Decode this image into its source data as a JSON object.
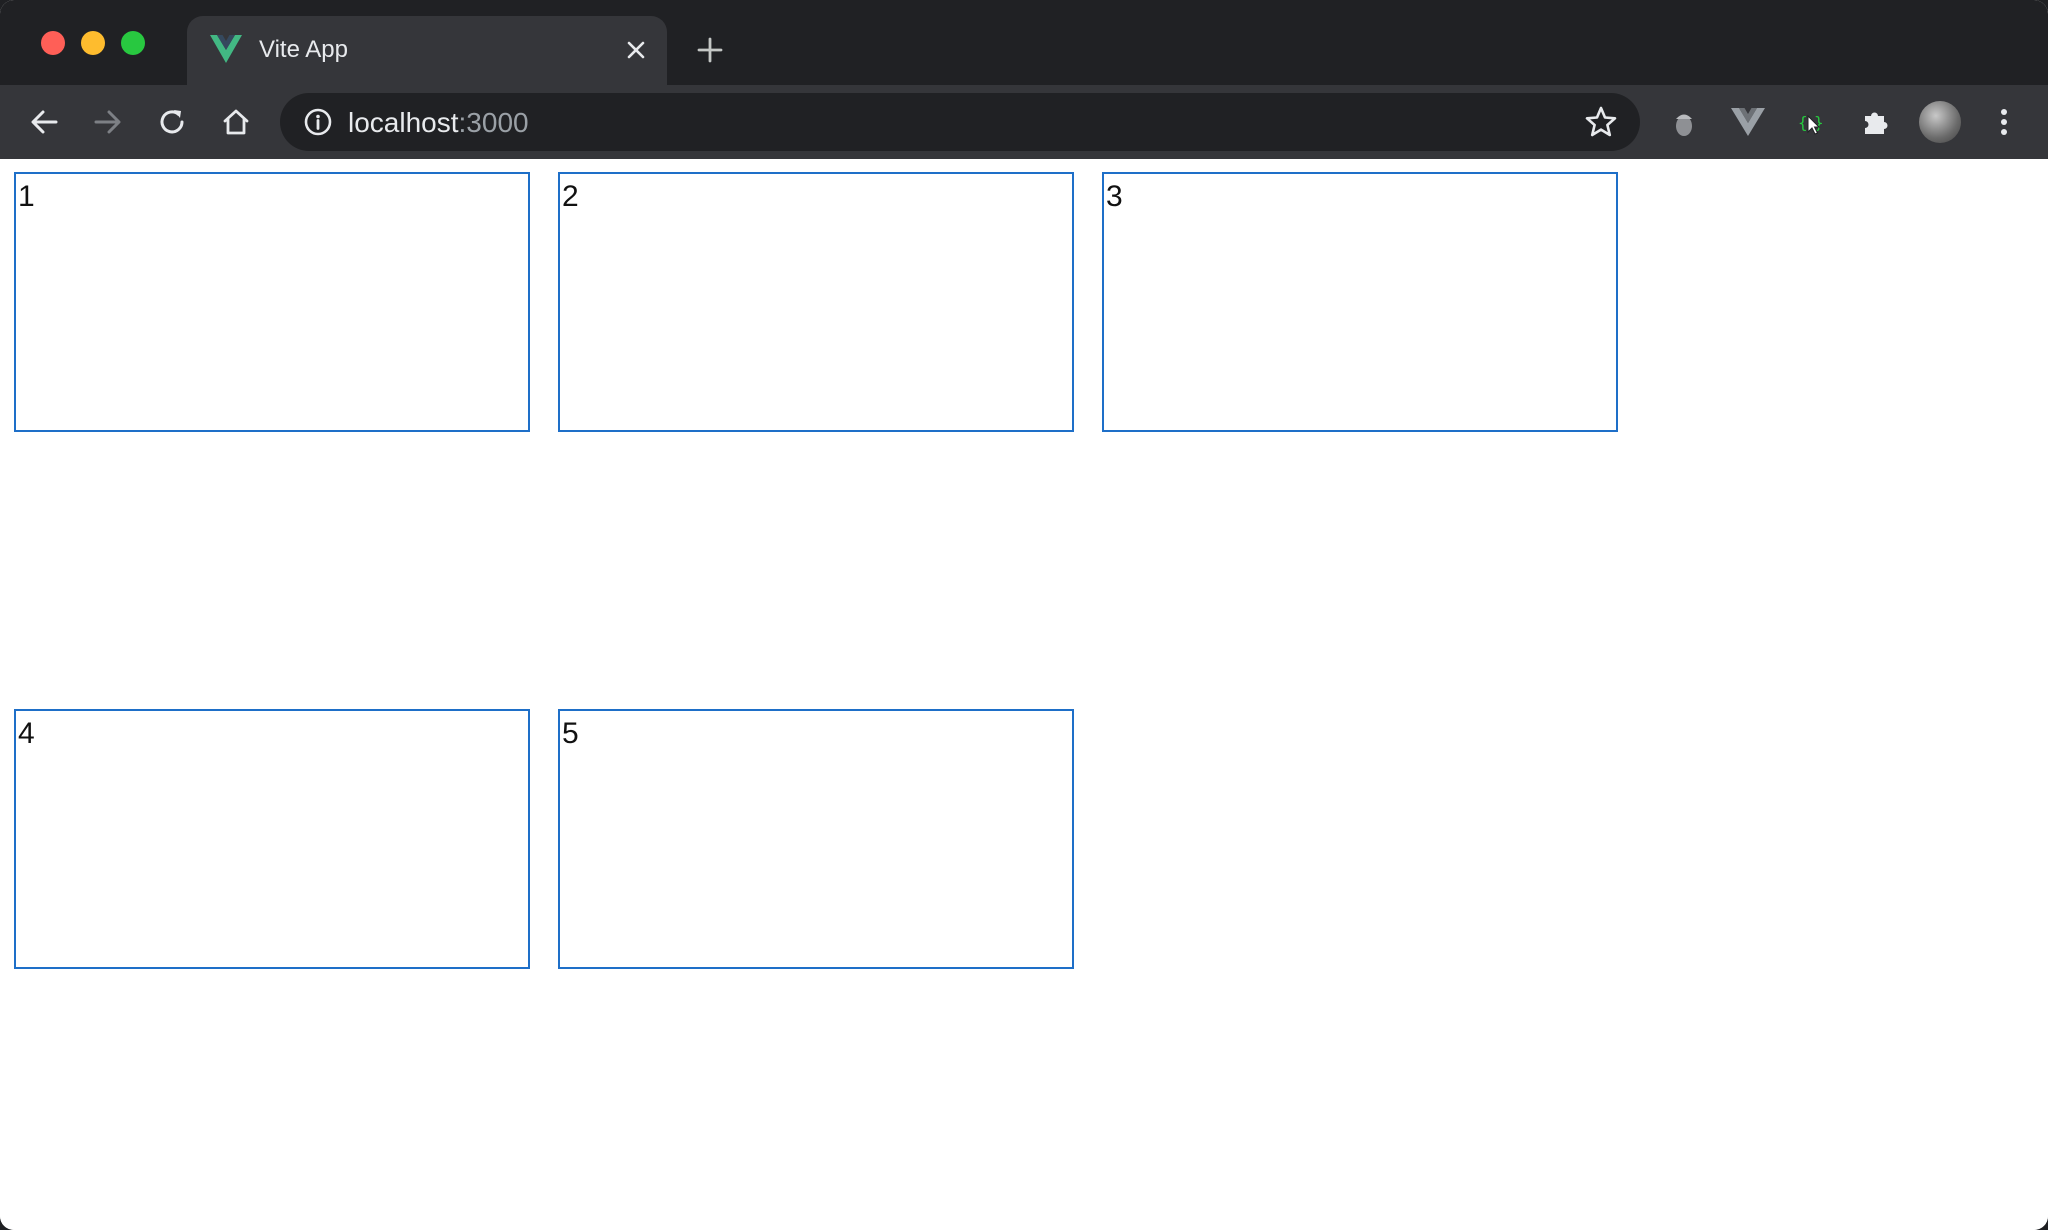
{
  "browser": {
    "tab": {
      "title": "Vite App",
      "favicon": "vue-logo-icon"
    },
    "address": {
      "host": "localhost",
      "port": ":3000"
    },
    "toolbar_icons": [
      "back-arrow-icon",
      "forward-arrow-icon",
      "reload-icon",
      "home-icon",
      "site-info-icon",
      "bookmark-star-icon"
    ],
    "extensions": [
      "acorn-extension-icon",
      "vue-devtools-icon",
      "cursor-extension-icon",
      "extensions-puzzle-icon",
      "profile-avatar",
      "menu-kebab-icon"
    ]
  },
  "page": {
    "cards": [
      {
        "label": "1"
      },
      {
        "label": "2"
      },
      {
        "label": "3"
      },
      {
        "label": "4"
      },
      {
        "label": "5"
      }
    ]
  },
  "colors": {
    "card_border": "#1e6fc8",
    "chrome_dark": "#202124",
    "chrome_toolbar": "#35363a",
    "vue_green": "#42b883"
  }
}
